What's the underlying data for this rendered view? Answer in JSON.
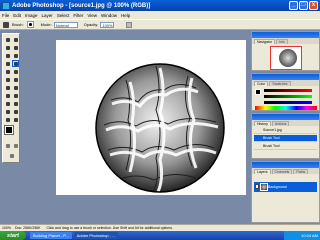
{
  "window": {
    "title": "Adobe Photoshop - [source1.jpg @ 100% (RGB)]",
    "minimize_label": "_",
    "maximize_label": "□",
    "close_label": "x"
  },
  "menu": {
    "items": [
      "File",
      "Edit",
      "Image",
      "Layer",
      "Select",
      "Filter",
      "View",
      "Window",
      "Help"
    ]
  },
  "options": {
    "brush_label": "Brush:",
    "mode_label": "Mode:",
    "mode_value": "Normal",
    "opacity_label": "Opacity:",
    "opacity_value": "100%"
  },
  "palettes": {
    "navigator": {
      "tabs": [
        "Navigator",
        "Info"
      ]
    },
    "color": {
      "tabs": [
        "Color",
        "Swatches"
      ]
    },
    "history": {
      "tabs": [
        "History",
        "Actions"
      ],
      "items": [
        "Source1.jpg",
        "Brush Tool",
        "Brush Tool"
      ]
    },
    "layers": {
      "tabs": [
        "Layers",
        "Channels",
        "Paths"
      ],
      "items": [
        "Background"
      ]
    }
  },
  "status": {
    "zoom": "100%",
    "doc": "Doc: 256K/256K",
    "hint": "Click and drag to use a brush or selection. Use Shift and Alt for additional options."
  },
  "taskbar": {
    "start_label": "start",
    "items": [
      "Building Planet - P...",
      "Adobe Photoshop - ..."
    ],
    "clock": "10:04 AM"
  },
  "colors": {
    "title_blue": "#0a5fd8",
    "workspace": "#7a8aa6"
  }
}
